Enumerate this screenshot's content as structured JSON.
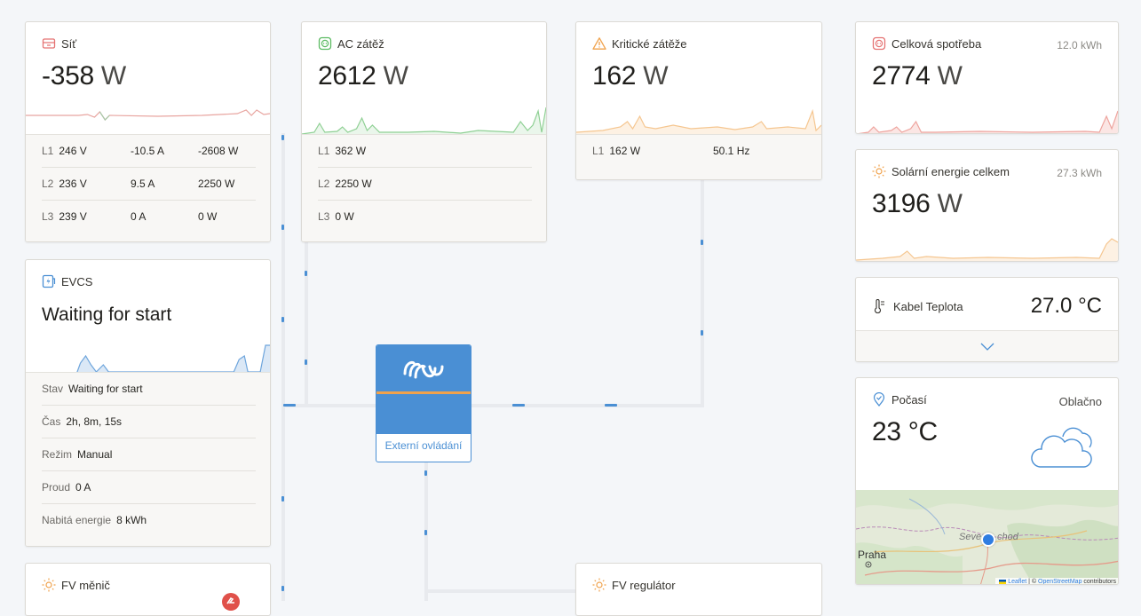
{
  "grid": {
    "title": "Síť",
    "value": "-358",
    "unit": "W",
    "phases": [
      {
        "label": "L1",
        "voltage": "246 V",
        "current": "-10.5 A",
        "power": "-2608 W"
      },
      {
        "label": "L2",
        "voltage": "236 V",
        "current": "9.5 A",
        "power": "2250 W"
      },
      {
        "label": "L3",
        "voltage": "239 V",
        "current": "0 A",
        "power": "0 W"
      }
    ]
  },
  "ac_load": {
    "title": "AC zátěž",
    "value": "2612",
    "unit": "W",
    "phases": [
      {
        "label": "L1",
        "power": "362 W"
      },
      {
        "label": "L2",
        "power": "2250 W"
      },
      {
        "label": "L3",
        "power": "0 W"
      }
    ]
  },
  "critical_load": {
    "title": "Kritické zátěže",
    "value": "162",
    "unit": "W",
    "phases": [
      {
        "label": "L1",
        "power": "162 W",
        "freq": "50.1 Hz"
      }
    ]
  },
  "total_consumption": {
    "title": "Celková spotřeba",
    "energy": "12.0 kWh",
    "value": "2774",
    "unit": "W"
  },
  "solar_total": {
    "title": "Solární energie celkem",
    "energy": "27.3 kWh",
    "value": "3196",
    "unit": "W"
  },
  "temperature": {
    "title": "Kabel Teplota",
    "value": "27.0 °C"
  },
  "weather": {
    "title": "Počasí",
    "condition": "Oblačno",
    "value": "23 °C",
    "map_city_left": "Praha",
    "map_city_right_a": "Seve",
    "map_city_right_b": "chod",
    "attribution_leaflet": "Leaflet",
    "attribution_sep": " | © ",
    "attribution_osm": "OpenStreetMap",
    "attribution_rest": " contributors"
  },
  "evcs": {
    "title": "EVCS",
    "status_big": "Waiting for start",
    "rows": [
      {
        "label": "Stav",
        "value": "Waiting for start"
      },
      {
        "label": "Čas",
        "value": "2h, 8m, 15s"
      },
      {
        "label": "Režim",
        "value": "Manual"
      },
      {
        "label": "Proud",
        "value": "0 A"
      },
      {
        "label": "Nabitá energie",
        "value": "8 kWh"
      }
    ]
  },
  "inverter": {
    "label": "Externí ovládání"
  },
  "pv_inverter": {
    "title": "FV měnič"
  },
  "pv_charger": {
    "title": "FV regulátor"
  },
  "colors": {
    "grid": "#e57373",
    "ac_load": "#5dbb63",
    "critical": "#f0a24c",
    "evcs": "#4a8fd4",
    "solar": "#f0a24c",
    "victron_blue": "#4a8fd4",
    "victron_orange": "#f0a24c"
  }
}
